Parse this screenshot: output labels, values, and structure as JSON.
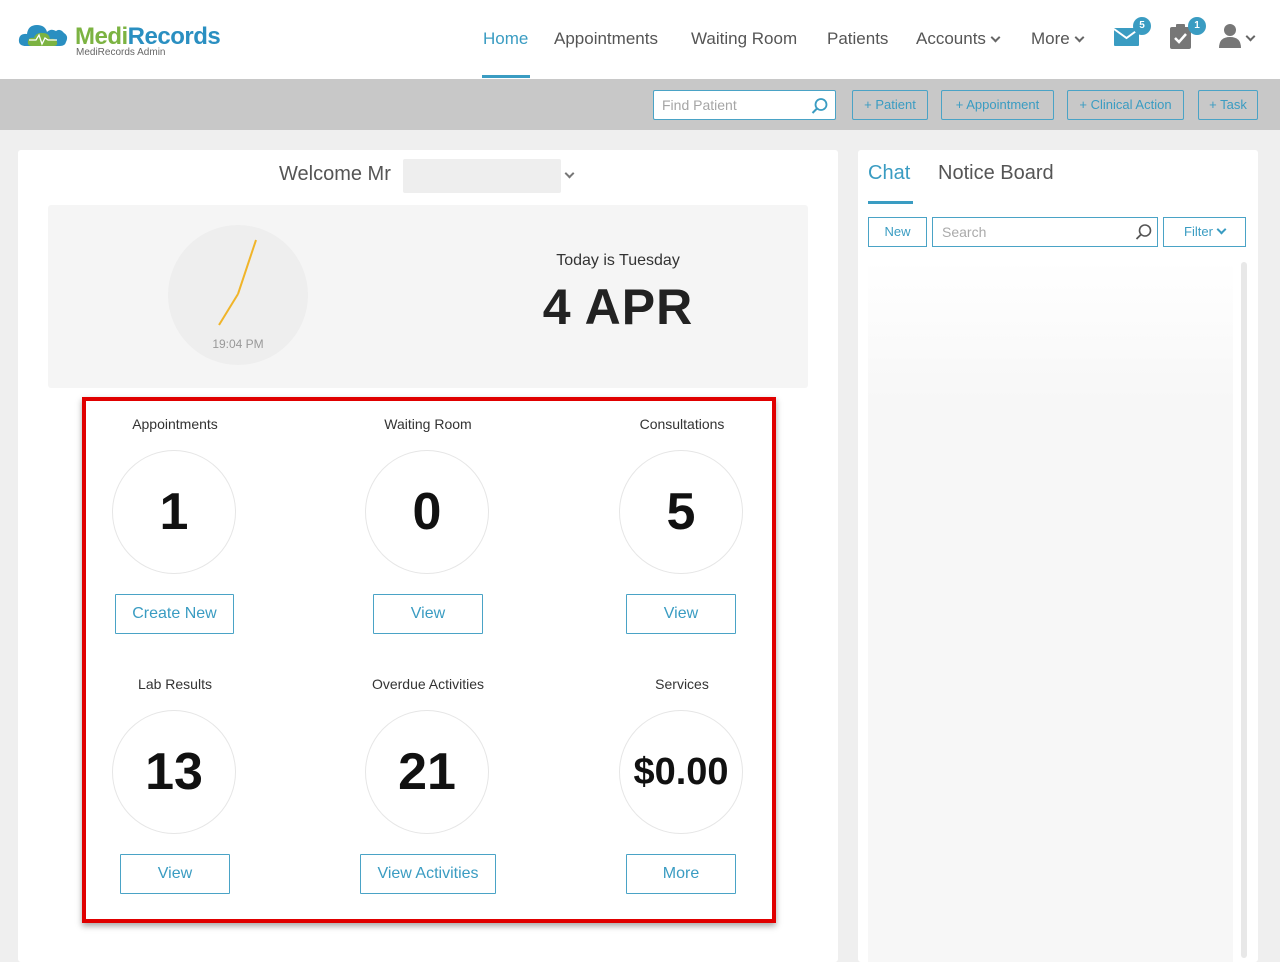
{
  "app": {
    "brand_part1": "Medi",
    "brand_part2": "Records",
    "subtitle": "MediRecords Admin"
  },
  "nav": {
    "items": [
      {
        "label": "Home",
        "active": true
      },
      {
        "label": "Appointments"
      },
      {
        "label": "Waiting Room"
      },
      {
        "label": "Patients"
      },
      {
        "label": "Accounts",
        "dropdown": true
      },
      {
        "label": "More",
        "dropdown": true
      }
    ],
    "messages_badge": "5",
    "tasks_badge": "1"
  },
  "toolbar": {
    "find_patient_placeholder": "Find Patient",
    "add_patient": "+ Patient",
    "add_appointment": "+ Appointment",
    "add_clinical_action": "+ Clinical Action",
    "add_task": "+ Task"
  },
  "welcome": {
    "greeting": "Welcome Mr"
  },
  "clock": {
    "time": "19:04 PM",
    "today_label": "Today is Tuesday",
    "date": "4 APR"
  },
  "stats": [
    {
      "label": "Appointments",
      "value": "1",
      "button": "Create New"
    },
    {
      "label": "Waiting Room",
      "value": "0",
      "button": "View"
    },
    {
      "label": "Consultations",
      "value": "5",
      "button": "View"
    },
    {
      "label": "Lab Results",
      "value": "13",
      "button": "View"
    },
    {
      "label": "Overdue Activities",
      "value": "21",
      "button": "View Activities"
    },
    {
      "label": "Services",
      "value": "$0.00",
      "button": "More"
    }
  ],
  "chat": {
    "tab_chat": "Chat",
    "tab_notice": "Notice Board",
    "new_button": "New",
    "search_placeholder": "Search",
    "filter_button": "Filter"
  },
  "colors": {
    "accent": "#3a9cc2",
    "brand_green": "#7cb342",
    "brand_blue": "#2a8fc1",
    "highlight": "#e00000",
    "clock_hand": "#f0b429"
  }
}
